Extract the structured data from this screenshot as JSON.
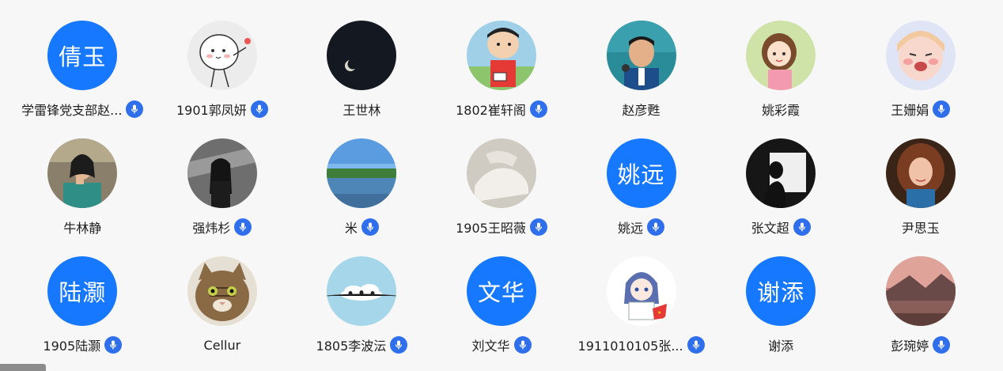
{
  "participants": [
    {
      "name": "学雷锋党支部赵...",
      "avatar_text": "倩玉",
      "avatar": "text",
      "mic": true
    },
    {
      "name": "1901郭凤妍",
      "avatar": "cartoon-sticker",
      "mic": true
    },
    {
      "name": "王世林",
      "avatar": "moon-night",
      "mic": false
    },
    {
      "name": "1802崔轩阁",
      "avatar": "cartoon-boy",
      "mic": true
    },
    {
      "name": "赵彦甦",
      "avatar": "man-speaking",
      "mic": false
    },
    {
      "name": "姚彩霞",
      "avatar": "illustrated-girl",
      "mic": false
    },
    {
      "name": "王姗娟",
      "avatar": "cartoon-girl-crying",
      "mic": true
    },
    {
      "name": "牛林静",
      "avatar": "girl-photo",
      "mic": false
    },
    {
      "name": "强炜杉",
      "avatar": "woman-escalator",
      "mic": true
    },
    {
      "name": "米",
      "avatar": "lake-landscape",
      "mic": true
    },
    {
      "name": "1905王昭薇",
      "avatar": "white-objects",
      "mic": true
    },
    {
      "name": "姚远",
      "avatar_text": "姚远",
      "avatar": "text",
      "mic": true
    },
    {
      "name": "张文超",
      "avatar": "silhouette",
      "mic": true
    },
    {
      "name": "尹思玉",
      "avatar": "woman-curly-hair",
      "mic": false
    },
    {
      "name": "1905陆灏",
      "avatar_text": "陆灏",
      "avatar": "text",
      "mic": true
    },
    {
      "name": "Cellur",
      "avatar": "cat",
      "mic": false
    },
    {
      "name": "1805李波沄",
      "avatar": "birds-on-wire",
      "mic": true
    },
    {
      "name": "刘文华",
      "avatar_text": "文华",
      "avatar": "text",
      "mic": true
    },
    {
      "name": "1911010105张...",
      "avatar": "anime-boy",
      "mic": true
    },
    {
      "name": "谢添",
      "avatar_text": "谢添",
      "avatar": "text",
      "mic": false
    },
    {
      "name": "彭琬婷",
      "avatar": "sunset-landscape",
      "mic": true
    }
  ],
  "colors": {
    "background": "#f7f7f8",
    "accent_blue": "#1677ff",
    "mic_badge": "#2f6fec"
  }
}
